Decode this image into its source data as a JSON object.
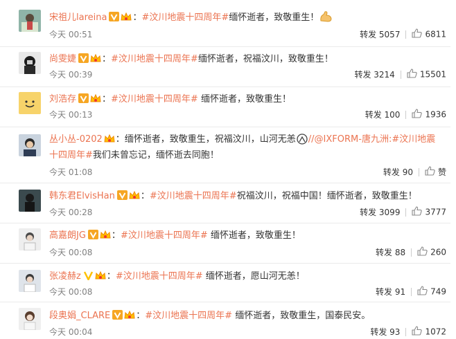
{
  "comments": [
    {
      "user": "宋祖儿lareina",
      "pre": "：",
      "tag": "#汶川地震十四周年#",
      "text": "缅怀逝者，致敬重生！",
      "time": "今天 00:51",
      "repost": "转发 5057",
      "likes": "6811",
      "emoji": "flexed-biceps"
    },
    {
      "user": "尚雯婕",
      "pre": "：",
      "tag": "#汶川地震十四周年#",
      "text": "缅怀逝者，祝福汶川，致敬重生！",
      "time": "今天 00:39",
      "repost": "转发 3214",
      "likes": "15501"
    },
    {
      "user": "刘浩存",
      "pre": "：",
      "tag": "#汶川地震十四周年#",
      "text": " 缅怀逝者，致敬重生！",
      "time": "今天 00:13",
      "repost": "转发 100",
      "likes": "1936"
    },
    {
      "user": "丛小丛-0202",
      "pre": "：缅怀逝者，致敬重生，祝福汶川，山河无恙",
      "mention": "//@IXFORM-唐九洲",
      "tag_a": ":#汶川地震",
      "tag_b": "十四周年#",
      "text": "我们未曾忘记，缅怀逝去同胞！",
      "time": "今天 01:08",
      "repost": "转发 90",
      "likes": "赞"
    },
    {
      "user": "韩东君ElvisHan",
      "pre": "：",
      "tag": "#汶川地震十四周年#",
      "text": "祝福汶川，祝福中国！缅怀逝者，致敬重生！",
      "time": "今天 00:28",
      "repost": "转发 3099",
      "likes": "3777"
    },
    {
      "user": "高嘉朗JG",
      "pre": "：",
      "tag": "#汶川地震十四周年#",
      "text": " 缅怀逝者，致敬重生！",
      "time": "今天 00:08",
      "repost": "转发 88",
      "likes": "260"
    },
    {
      "user": "张凌赫z",
      "pre": "：",
      "tag": "#汶川地震十四周年#",
      "text": " 缅怀逝者，愿山河无恙！",
      "time": "今天 00:08",
      "repost": "转发 91",
      "likes": "749"
    },
    {
      "user": "段奥娟_CLARE",
      "pre": "：",
      "tag": "#汶川地震十四周年#",
      "text": " 缅怀逝者，致敬重生，国泰民安。",
      "time": "今天 00:04",
      "repost": "转发 93",
      "likes": "1072"
    }
  ],
  "colors": {
    "accent": "#eb7350",
    "verified": "#f6a623",
    "verified_gold": "#ffc000",
    "text": "#333333",
    "muted": "#808080"
  }
}
